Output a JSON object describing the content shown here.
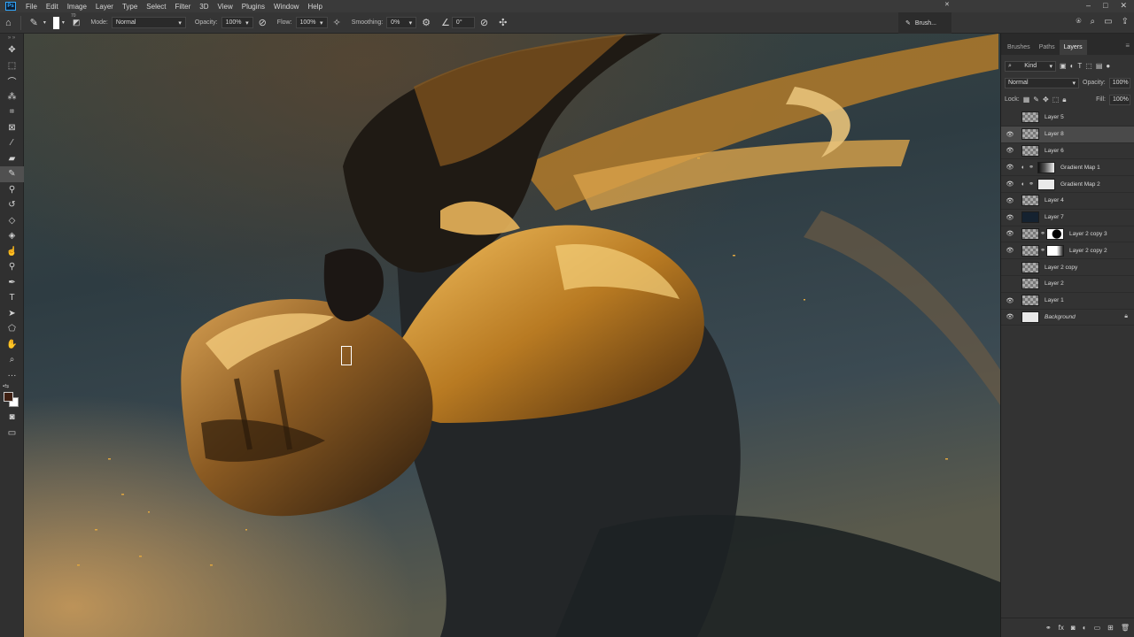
{
  "menubar": {
    "logo": "Ps",
    "items": [
      "File",
      "Edit",
      "Image",
      "Layer",
      "Type",
      "Select",
      "Filter",
      "3D",
      "View",
      "Plugins",
      "Window",
      "Help"
    ],
    "minimize": "–",
    "maximize": "□",
    "close": "✕"
  },
  "options": {
    "brush_size": "70",
    "mode_label": "Mode:",
    "mode_value": "Normal",
    "opacity_label": "Opacity:",
    "opacity_value": "100%",
    "flow_label": "Flow:",
    "flow_value": "100%",
    "smoothing_label": "Smoothing:",
    "smoothing_value": "0%",
    "angle_value": "0°"
  },
  "brush_panel": {
    "label": "Brush...",
    "close": "✕"
  },
  "panel": {
    "tabs": [
      "Brushes",
      "Paths",
      "Layers"
    ],
    "active_tab": "Layers",
    "filter_kind": "Kind",
    "blend_mode": "Normal",
    "opacity_label": "Opacity:",
    "opacity_value": "100%",
    "lock_label": "Lock:",
    "fill_label": "Fill:",
    "fill_value": "100%"
  },
  "layers": [
    {
      "name": "Layer 5",
      "visible": false,
      "thumb": "checker",
      "selected": false
    },
    {
      "name": "Layer 8",
      "visible": true,
      "thumb": "checker",
      "selected": true
    },
    {
      "name": "Layer 6",
      "visible": true,
      "thumb": "checker",
      "selected": false
    },
    {
      "name": "Gradient Map 1",
      "visible": true,
      "thumb": "grad",
      "selected": false,
      "adjustment": true
    },
    {
      "name": "Gradient Map 2",
      "visible": true,
      "thumb": "white",
      "selected": false,
      "adjustment": true
    },
    {
      "name": "Layer 4",
      "visible": true,
      "thumb": "checker",
      "selected": false
    },
    {
      "name": "Layer 7",
      "visible": true,
      "thumb": "dark",
      "selected": false
    },
    {
      "name": "Layer 2 copy 3",
      "visible": true,
      "thumb": "checker",
      "mask": "blackmask",
      "selected": false
    },
    {
      "name": "Layer 2 copy 2",
      "visible": true,
      "thumb": "checker",
      "mask": "mask2",
      "selected": false
    },
    {
      "name": "Layer 2 copy",
      "visible": false,
      "thumb": "checker",
      "selected": false
    },
    {
      "name": "Layer 2",
      "visible": false,
      "thumb": "checker",
      "selected": false
    },
    {
      "name": "Layer 1",
      "visible": true,
      "thumb": "checker",
      "selected": false
    },
    {
      "name": "Background",
      "visible": true,
      "thumb": "white",
      "selected": false,
      "locked": true
    }
  ],
  "colors": {
    "foreground": "#3e1f12",
    "background": "#ffffff",
    "accent": "#31a8ff"
  }
}
